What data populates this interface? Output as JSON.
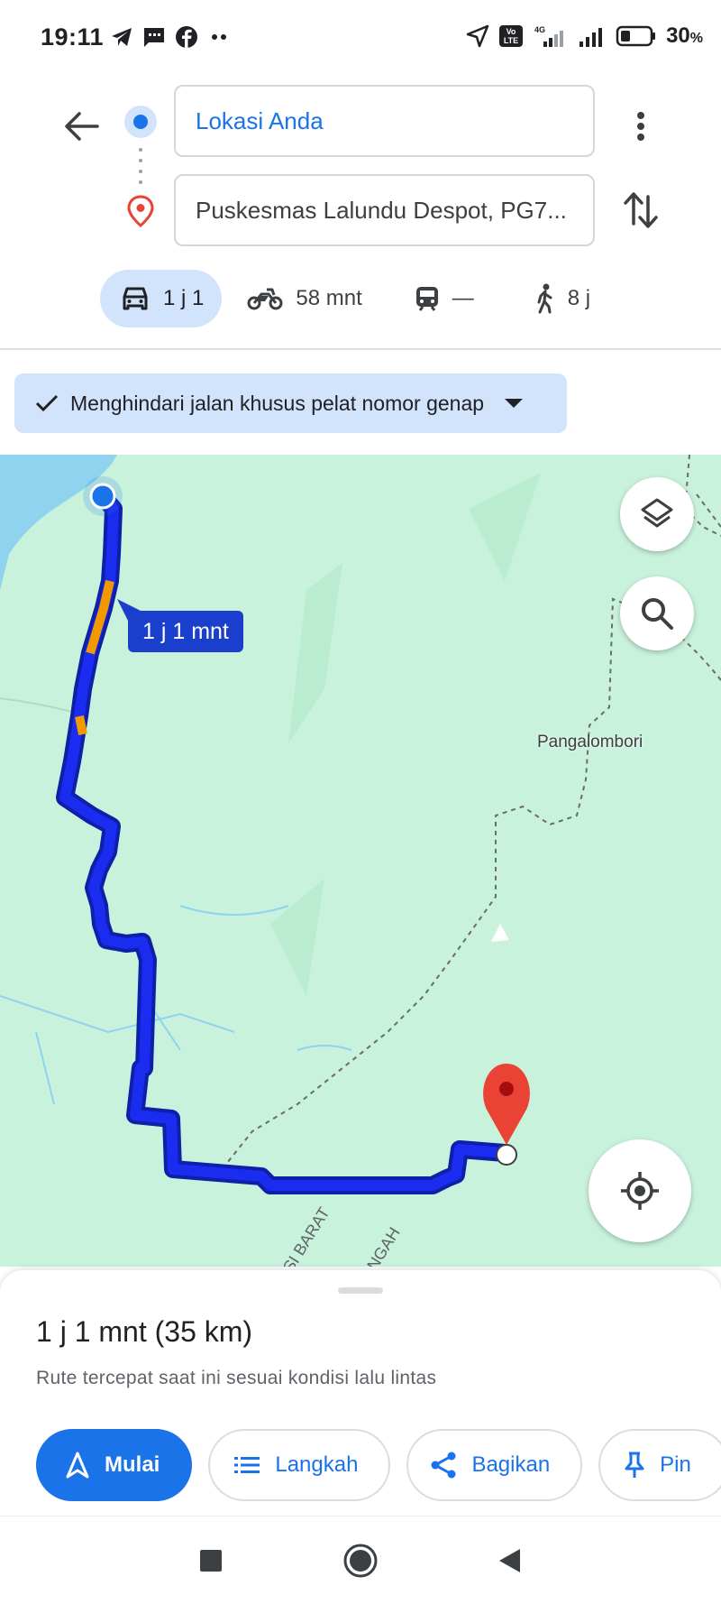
{
  "status_bar": {
    "time": "19:11",
    "battery": "30",
    "battery_unit": "%",
    "network": "4G",
    "volte": "Vo LTE"
  },
  "directions": {
    "origin": "Lokasi Anda",
    "destination": "Puskesmas Lalundu Despot, PG7...",
    "modes": [
      {
        "name": "car",
        "label": "1 j 1"
      },
      {
        "name": "motorcycle",
        "label": "58 mnt"
      },
      {
        "name": "transit",
        "label": "—"
      },
      {
        "name": "walk",
        "label": "8 j"
      }
    ]
  },
  "chip": {
    "label": "Menghindari jalan khusus pelat nomor genap"
  },
  "map": {
    "place_label": "Pangalombori",
    "route_time_label": "1 j 1 mnt",
    "road_labels": [
      "SI BARAT",
      "NGAH"
    ],
    "colors": {
      "route": "#1a2cf0",
      "traffic": "#f29900",
      "pin": "#ea4335",
      "land": "#c9f2dc",
      "water": "#8fd3ef"
    }
  },
  "sheet": {
    "summary": "1 j 1 mnt (35 km)",
    "subtext": "Rute tercepat saat ini sesuai kondisi lalu lintas",
    "buttons": {
      "start": "Mulai",
      "steps": "Langkah",
      "share": "Bagikan",
      "pin": "Pin"
    }
  },
  "icons": {
    "back": "arrow-left-icon",
    "more": "more-vert-icon",
    "swap": "swap-vert-icon",
    "layers": "layers-icon",
    "search": "search-icon",
    "locate": "my-location-icon"
  }
}
